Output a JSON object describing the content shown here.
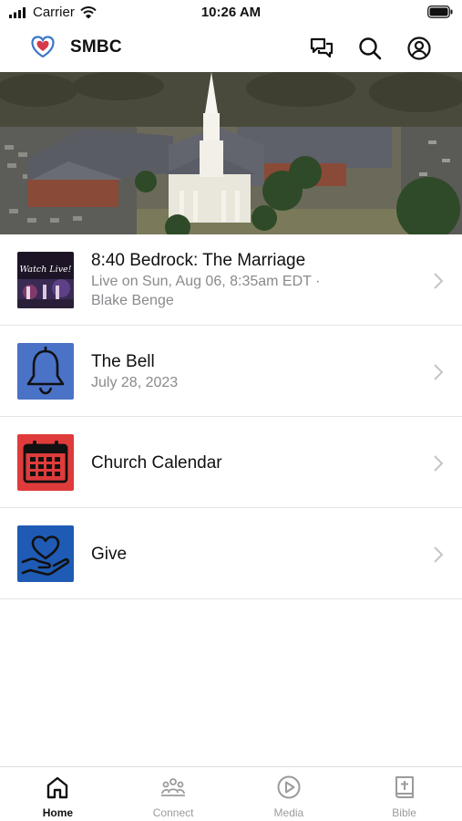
{
  "status_bar": {
    "carrier": "Carrier",
    "time": "10:26 AM"
  },
  "header": {
    "title": "SMBC",
    "icons": [
      "messages-icon",
      "search-icon",
      "account-icon"
    ]
  },
  "hero": {
    "icon": "church-photo"
  },
  "list": [
    {
      "title": "8:40 Bedrock: The Marriage",
      "subtitle": "Live on Sun, Aug 06, 8:35am EDT ·",
      "subtitle2": "Blake Benge",
      "thumb_text": "Watch Live!"
    },
    {
      "title": "The Bell",
      "subtitle": "July 28, 2023",
      "icon": "bell-icon",
      "color": "#4a72c6"
    },
    {
      "title": "Church Calendar",
      "icon": "calendar-icon",
      "color": "#e03b3b"
    },
    {
      "title": "Give",
      "icon": "heart-hand-icon",
      "color": "#1f5bb5"
    }
  ],
  "tabs": [
    {
      "label": "Home",
      "icon": "home-icon",
      "active": true
    },
    {
      "label": "Connect",
      "icon": "group-icon",
      "active": false
    },
    {
      "label": "Media",
      "icon": "play-icon",
      "active": false
    },
    {
      "label": "Bible",
      "icon": "bible-icon",
      "active": false
    }
  ],
  "colors": {
    "accent": "#111111",
    "inactive": "#9b9b9b",
    "logo_red": "#d63a4a",
    "logo_blue": "#3a78c7"
  }
}
